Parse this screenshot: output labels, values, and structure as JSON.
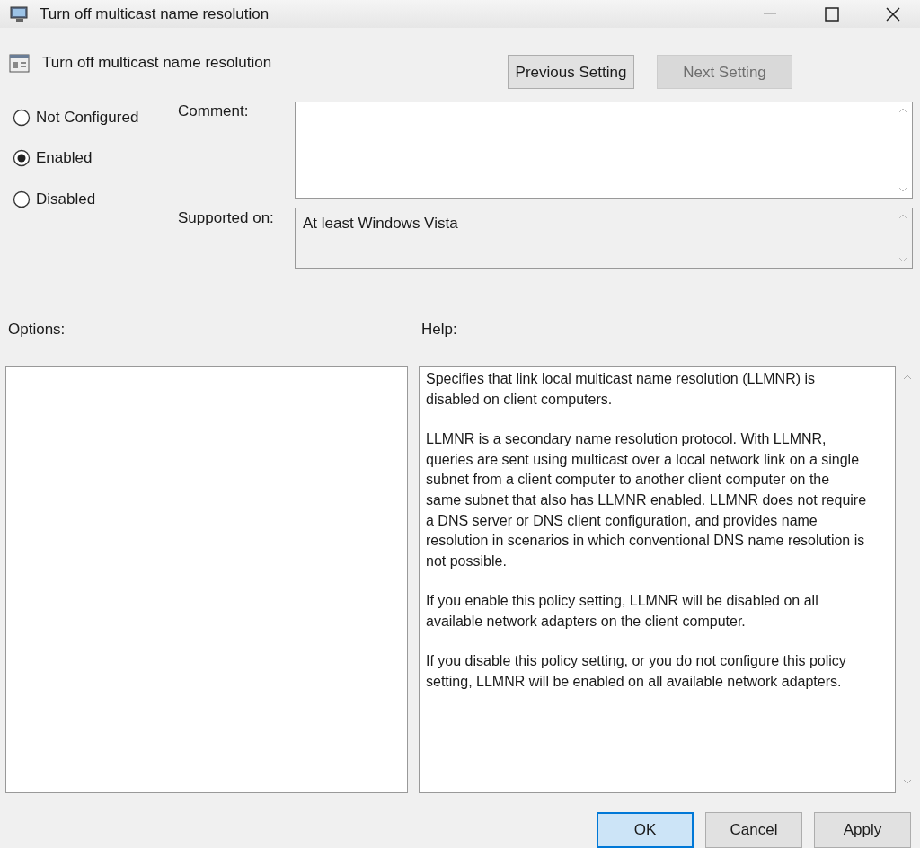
{
  "window": {
    "title": "Turn off multicast name resolution"
  },
  "policy": {
    "title": "Turn off multicast name resolution"
  },
  "nav_buttons": [
    {
      "label": "Previous Setting",
      "disabled": false
    },
    {
      "label": "Next Setting",
      "disabled": true
    }
  ],
  "states": [
    {
      "label": "Not Configured",
      "selected": false
    },
    {
      "label": "Enabled",
      "selected": true
    },
    {
      "label": "Disabled",
      "selected": false
    }
  ],
  "comment": {
    "label": "Comment:"
  },
  "supported": {
    "label": "Supported on:",
    "value": "At least Windows Vista"
  },
  "options": {
    "label": "Options:"
  },
  "help": {
    "label": "Help:",
    "paragraphs": [
      "Specifies that link local multicast name resolution (LLMNR) is disabled on client computers.",
      "LLMNR is a secondary name resolution protocol. With LLMNR, queries are sent using multicast over a local network link on a single subnet from a client computer to another client computer on the same subnet that also has LLMNR enabled. LLMNR does not require a DNS server or DNS client configuration, and provides name resolution in scenarios in which conventional DNS name resolution is not possible.",
      "If you enable this policy setting, LLMNR will be disabled on all available network adapters on the client computer.",
      "If you disable this policy setting, or you do not configure this policy setting, LLMNR will be enabled on all available network adapters."
    ]
  },
  "buttons": [
    {
      "label": "OK",
      "highlighted": true
    },
    {
      "label": "Cancel",
      "highlighted": false
    },
    {
      "label": "Apply",
      "highlighted": false
    }
  ]
}
